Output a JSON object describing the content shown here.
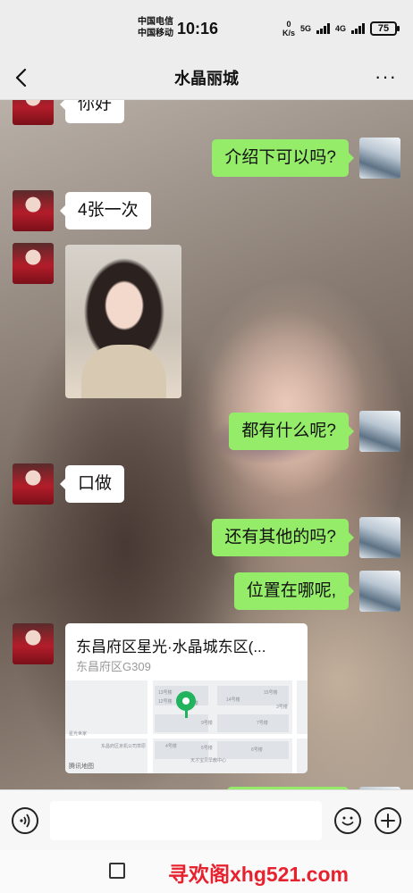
{
  "status_bar": {
    "carrier_1": "中国电信",
    "carrier_2": "中国移动",
    "time": "10:16",
    "net_speed_value": "0",
    "net_speed_unit": "K/s",
    "signal_tag_1": "5G",
    "signal_tag_2": "4G",
    "battery": "75"
  },
  "header": {
    "title": "水晶丽城",
    "back_icon": "chevron-left-icon",
    "more_label": "···"
  },
  "messages": [
    {
      "side": "in",
      "type": "text",
      "text": "你好"
    },
    {
      "side": "out",
      "type": "text",
      "text": "介绍下可以吗?"
    },
    {
      "side": "in",
      "type": "text",
      "text": "4张一次"
    },
    {
      "side": "in",
      "type": "image"
    },
    {
      "side": "out",
      "type": "text",
      "text": "都有什么呢?"
    },
    {
      "side": "in",
      "type": "text",
      "text": "口做"
    },
    {
      "side": "out",
      "type": "text",
      "text": "还有其他的吗?"
    },
    {
      "side": "out",
      "type": "text",
      "text": "位置在哪呢,"
    },
    {
      "side": "in",
      "type": "location",
      "name": "东昌府区星光·水晶城东区(...",
      "address": "东昌府区G309"
    }
  ],
  "map": {
    "labels": [
      "13号楼",
      "14号楼",
      "15号楼",
      "12号楼",
      "8号楼",
      "9号楼",
      "7号楼",
      "4号楼",
      "5号楼",
      "6号楼",
      "3号楼",
      "星光世家",
      "东昌府区京机公司草原",
      "天才宝贝早教中心"
    ],
    "brand": "腾讯地图"
  },
  "input_bar": {
    "voice_icon": "voice-icon",
    "emoji_icon": "emoji-icon",
    "plus_icon": "plus-icon",
    "placeholder": ""
  },
  "nav_bar": {
    "recents_icon": "square-icon",
    "watermark": "寻欢阁xhg521.com"
  },
  "colors": {
    "out_bubble": "#95ec69",
    "in_bubble": "#ffffff",
    "map_pin": "#22b35e",
    "watermark": "#e8212e"
  }
}
